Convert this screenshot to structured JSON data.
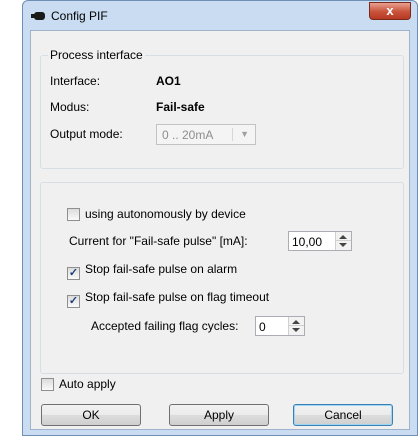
{
  "window": {
    "title": "Config PIF",
    "close_glyph": "x"
  },
  "process_interface": {
    "legend": "Process interface",
    "interface_label": "Interface:",
    "interface_value": "AO1",
    "modus_label": "Modus:",
    "modus_value": "Fail-safe",
    "output_mode_label": "Output mode:",
    "output_mode_value": "0 .. 20mA"
  },
  "settings": {
    "autonomous_label": "using autonomously by device",
    "autonomous_checked": false,
    "current_label": "Current for \"Fail-safe pulse\" [mA]:",
    "current_value": "10,00",
    "stop_alarm_label": "Stop fail-safe pulse on alarm",
    "stop_alarm_checked": true,
    "stop_flag_label": "Stop fail-safe pulse on flag timeout",
    "stop_flag_checked": true,
    "accepted_cycles_label": "Accepted failing flag cycles:",
    "accepted_cycles_value": "0"
  },
  "footer": {
    "auto_apply_label": "Auto apply",
    "auto_apply_checked": false,
    "ok_label": "OK",
    "apply_label": "Apply",
    "cancel_label": "Cancel"
  },
  "colors": {
    "frame": "#c9dcf1",
    "client": "#f0f0f0",
    "close_button": "#c8523a",
    "check_mark": "#1f3f7a"
  }
}
